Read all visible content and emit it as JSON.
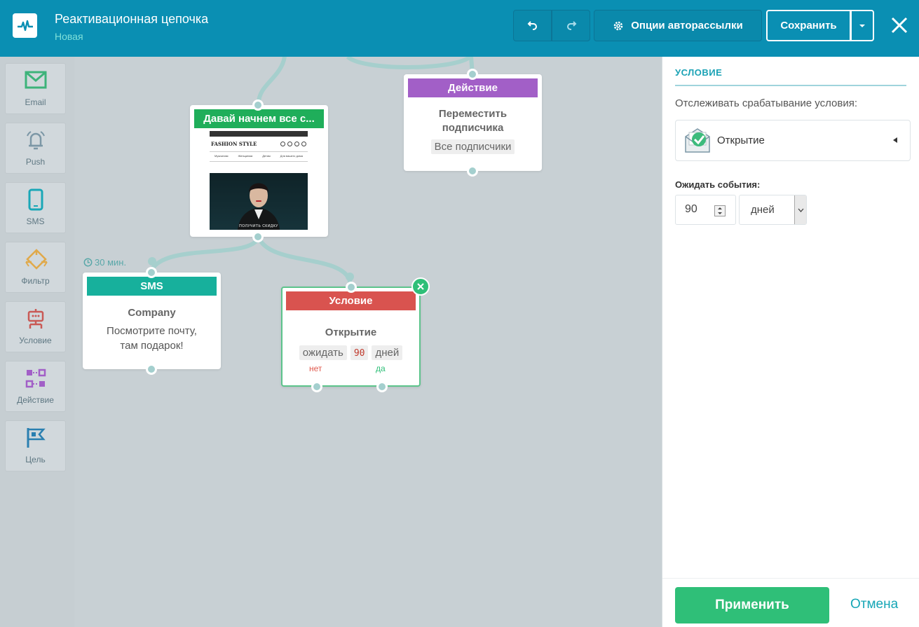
{
  "header": {
    "title": "Реактивационная цепочка",
    "status": "Новая",
    "options_label": "Опции авторассылки",
    "save_label": "Сохранить"
  },
  "toolbar": {
    "items": [
      {
        "label": "Email",
        "icon": "mail-icon",
        "color": "#3db37a"
      },
      {
        "label": "Push",
        "icon": "bell-icon",
        "color": "#7c97a6"
      },
      {
        "label": "SMS",
        "icon": "phone-icon",
        "color": "#1aa7b7"
      },
      {
        "label": "Фильтр",
        "icon": "filter-icon",
        "color": "#e0a94a"
      },
      {
        "label": "Условие",
        "icon": "robot-icon",
        "color": "#c95a56"
      },
      {
        "label": "Действие",
        "icon": "action-icon",
        "color": "#a25fc7"
      },
      {
        "label": "Цель",
        "icon": "flag-icon",
        "color": "#2a7fb0"
      }
    ]
  },
  "canvas": {
    "email_node": {
      "title": "Давай начнем все с...",
      "preview_brand": "FASHION STYLE",
      "preview_nav": [
        "Мужчинам",
        "Женщинам",
        "Детям",
        "Для вашего дома"
      ],
      "preview_cta": "ПОЛУЧИТЬ СКИДКУ"
    },
    "action_node": {
      "header": "Действие",
      "title": "Переместить подписчика",
      "chip": "Все подписчики"
    },
    "sms_node": {
      "delay": "30 мин.",
      "header": "SMS",
      "title": "Company",
      "text": "Посмотрите почту, там подарок!"
    },
    "condition_node": {
      "header": "Условие",
      "title": "Открытие",
      "chip_wait": "ожидать",
      "chip_value": "90",
      "chip_unit": "дней",
      "no_label": "нет",
      "yes_label": "да"
    }
  },
  "panel": {
    "title": "УСЛОВИЕ",
    "track_label": "Отслеживать срабатывание условия:",
    "condition_value": "Открытие",
    "wait_label": "Ожидать события:",
    "wait_value": "90",
    "wait_unit": "дней",
    "apply_label": "Применить",
    "cancel_label": "Отмена"
  },
  "colors": {
    "header_bg": "#0a8fb3",
    "email_head": "#1fae5a",
    "action_head": "#a25fc7",
    "sms_head": "#17b09c",
    "condition_head": "#d9534f",
    "apply": "#2fbf78"
  }
}
